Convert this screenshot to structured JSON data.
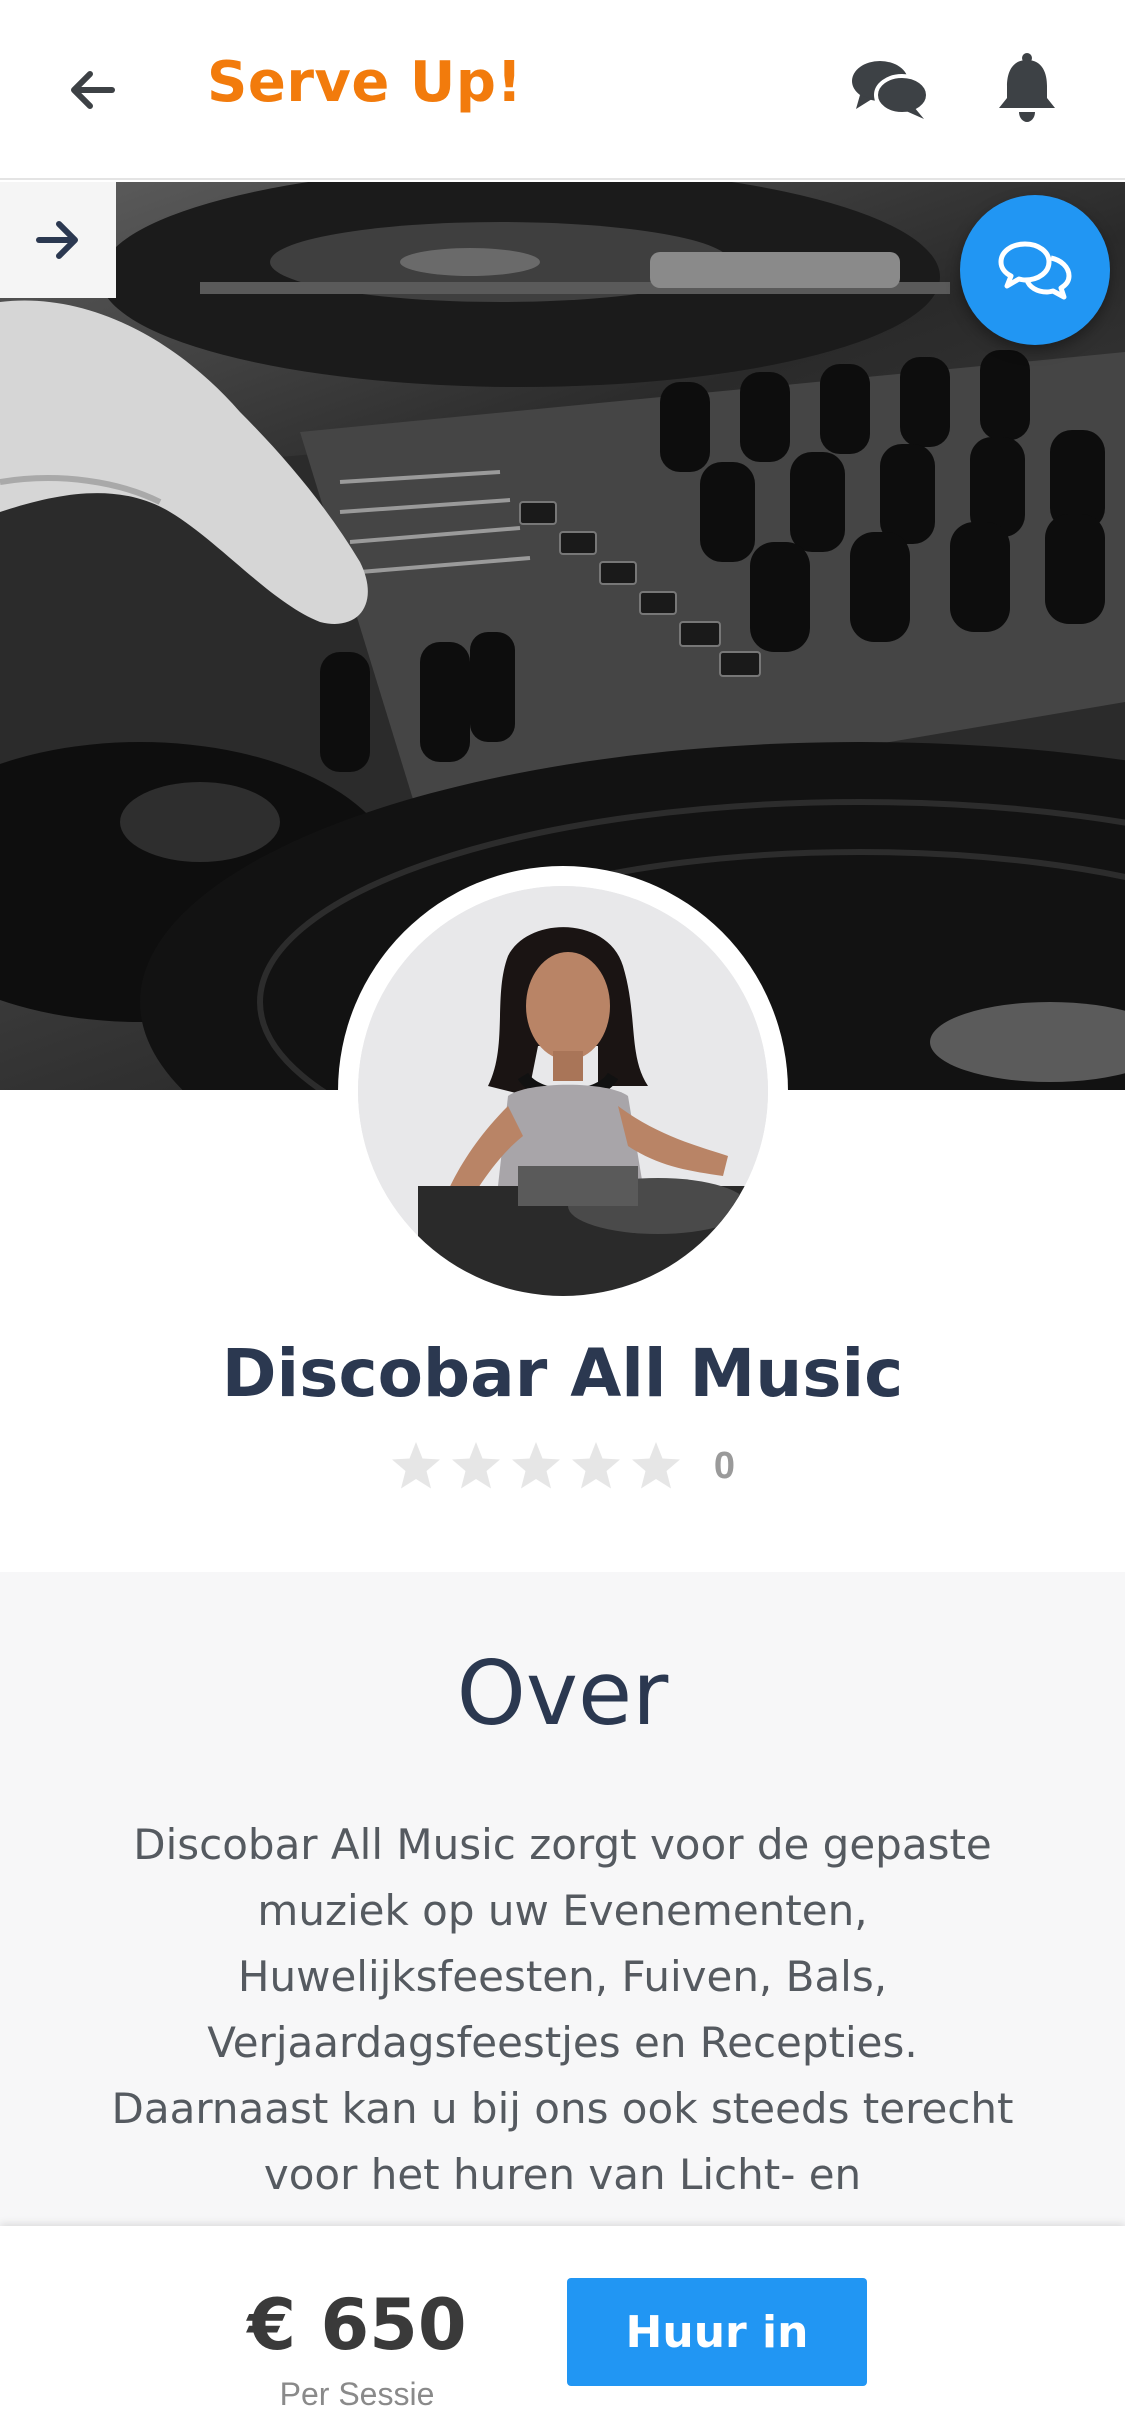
{
  "header": {
    "back_icon": "arrow-left-icon",
    "title": "Serve Up!",
    "chat_icon": "chat-bubbles-icon",
    "notification_icon": "bell-icon"
  },
  "hero": {
    "toggle_icon": "arrow-right-icon",
    "fab_icon": "chat-bubbles-outline-icon",
    "fab_color": "#2196f3"
  },
  "profile": {
    "name": "Discobar All Music",
    "rating_stars": 0,
    "rating_max": 5,
    "rating_count": "0"
  },
  "about": {
    "title": "Over",
    "text": "Discobar All Music zorgt voor de gepaste muziek op uw Evenementen, Huwelijksfeesten, Fuiven, Bals, Verjaardagsfeestjes en Recepties. Daarnaast kan u bij ons ook steeds terecht voor het huren van Licht- en"
  },
  "bottom_bar": {
    "price": "€ 650",
    "price_unit": "Per Sessie",
    "hire_label": "Huur in"
  },
  "colors": {
    "brand": "#f27b0c",
    "accent": "#2196f3",
    "name_text": "#2b3850"
  }
}
